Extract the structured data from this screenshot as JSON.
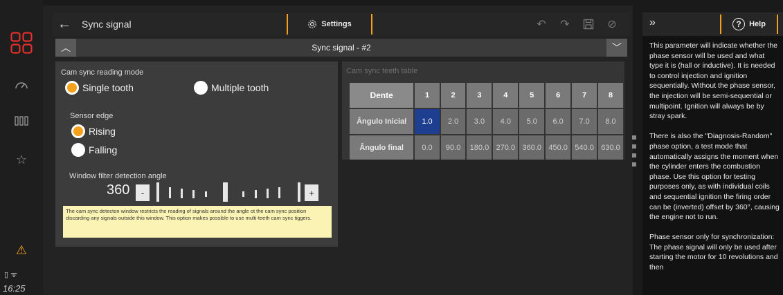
{
  "window": {
    "title": "Sync signal"
  },
  "toolbar": {
    "settings_label": "Settings"
  },
  "sync_select": {
    "value": "Sync signal - #2"
  },
  "cam": {
    "mode_label": "Cam sync reading mode",
    "mode_options": [
      "Single tooth",
      "Multiple tooth"
    ],
    "mode_selected": "Single tooth",
    "edge_label": "Sensor edge",
    "edge_options": [
      "Rising",
      "Falling"
    ],
    "edge_selected": "Rising",
    "window_label": "Window filter detection angle",
    "window_value": "360",
    "minus": "-",
    "plus": "+",
    "note": "The cam sync detecton window restricts the reading of signals around the angle ot the cam sync position discarding any signals outside this window. This option makes possible to use multi-teeth cam sync tiggers."
  },
  "teeth": {
    "title": "Cam sync teeth table",
    "header": "Dente",
    "columns": [
      "1",
      "2",
      "3",
      "4",
      "5",
      "6",
      "7",
      "8"
    ],
    "rows": [
      {
        "label": "Ângulo Inicial",
        "values": [
          "1.0",
          "2.0",
          "3.0",
          "4.0",
          "5.0",
          "6.0",
          "7.0",
          "8.0"
        ]
      },
      {
        "label": "Ângulo final",
        "values": [
          "0.0",
          "90.0",
          "180.0",
          "270.0",
          "360.0",
          "450.0",
          "540.0",
          "630.0"
        ]
      }
    ]
  },
  "help": {
    "label": "Help",
    "text": "This parameter will indicate whether the phase sensor will be used and what type it is (hall or inductive). It is needed to control injection and ignition sequentially. Without the phase sensor, the injection will be semi-sequential or multipoint. Ignition will always be by stray spark.\n\nThere is also the \"Diagnosis-Random\" phase option, a test mode that automatically assigns the moment when the cylinder enters the combustion phase. Use this option for testing purposes only, as with individual coils and sequential ignition the firing order can be (inverted) offset by 360°, causing the engine not to run.\n\nPhase sensor only for synchronization: The phase signal will only be used after starting the motor for 10 revolutions and then"
  },
  "status": {
    "time": "16:25"
  },
  "colors": {
    "accent": "#f5a11c",
    "logo": "#e0312b",
    "selected_cell": "#1e3f8f",
    "note_bg": "#fbf3b3"
  }
}
